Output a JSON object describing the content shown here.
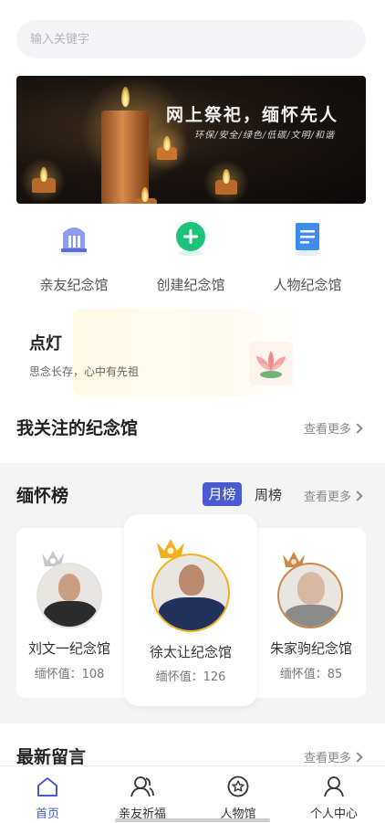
{
  "search": {
    "placeholder": "输入关键字"
  },
  "banner": {
    "title": "网上祭祀，缅怀先人",
    "subtitle": "环保/安全/绿色/低碳/文明/和谐"
  },
  "quick_actions": [
    {
      "label": "亲友纪念馆",
      "icon": "memorial-hall-icon",
      "color": "#6c7ee0"
    },
    {
      "label": "创建纪念馆",
      "icon": "plus-circle-icon",
      "color": "#1ec27a"
    },
    {
      "label": "人物纪念馆",
      "icon": "document-icon",
      "color": "#3f8cf0"
    }
  ],
  "lamp": {
    "title": "点灯",
    "subtitle": "思念长存，心中有先祖"
  },
  "follow": {
    "title": "我关注的纪念馆",
    "more": "查看更多"
  },
  "ranking": {
    "title": "缅怀榜",
    "tabs": [
      "月榜",
      "周榜"
    ],
    "active_tab": "月榜",
    "more": "查看更多",
    "items": [
      {
        "rank": 2,
        "name": "刘文一纪念馆",
        "value_label": "缅怀值：108"
      },
      {
        "rank": 1,
        "name": "徐太让纪念馆",
        "value_label": "缅怀值：126"
      },
      {
        "rank": 3,
        "name": "朱家驹纪念馆",
        "value_label": "缅怀值：85"
      }
    ]
  },
  "latest": {
    "title": "最新留言",
    "more": "查看更多"
  },
  "tabbar": [
    {
      "label": "首页",
      "icon": "home-icon",
      "active": true
    },
    {
      "label": "亲友祈福",
      "icon": "users-icon",
      "active": false
    },
    {
      "label": "人物馆",
      "icon": "star-circle-icon",
      "active": false
    },
    {
      "label": "个人中心",
      "icon": "user-icon",
      "active": false
    }
  ],
  "colors": {
    "accent": "#4a5bd1",
    "gold": "#f2b01e",
    "silver": "#c7c7c7",
    "bronze": "#c8894a"
  }
}
